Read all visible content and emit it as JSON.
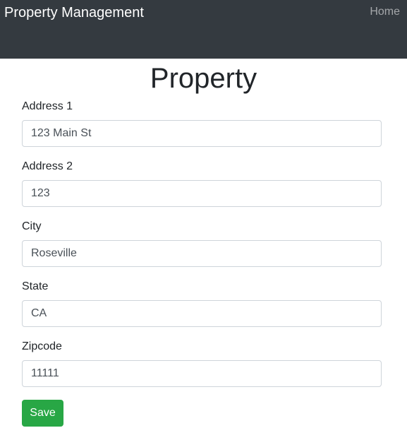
{
  "navbar": {
    "brand": "Property Management",
    "home_link": "Home"
  },
  "page": {
    "title": "Property"
  },
  "form": {
    "fields": [
      {
        "label": "Address 1",
        "value": "123 Main St"
      },
      {
        "label": "Address 2",
        "value": "123"
      },
      {
        "label": "City",
        "value": "Roseville"
      },
      {
        "label": "State",
        "value": "CA"
      },
      {
        "label": "Zipcode",
        "value": "11111"
      }
    ],
    "save_label": "Save"
  },
  "colors": {
    "navbar_bg": "#343a40",
    "save_button": "#28a745"
  }
}
